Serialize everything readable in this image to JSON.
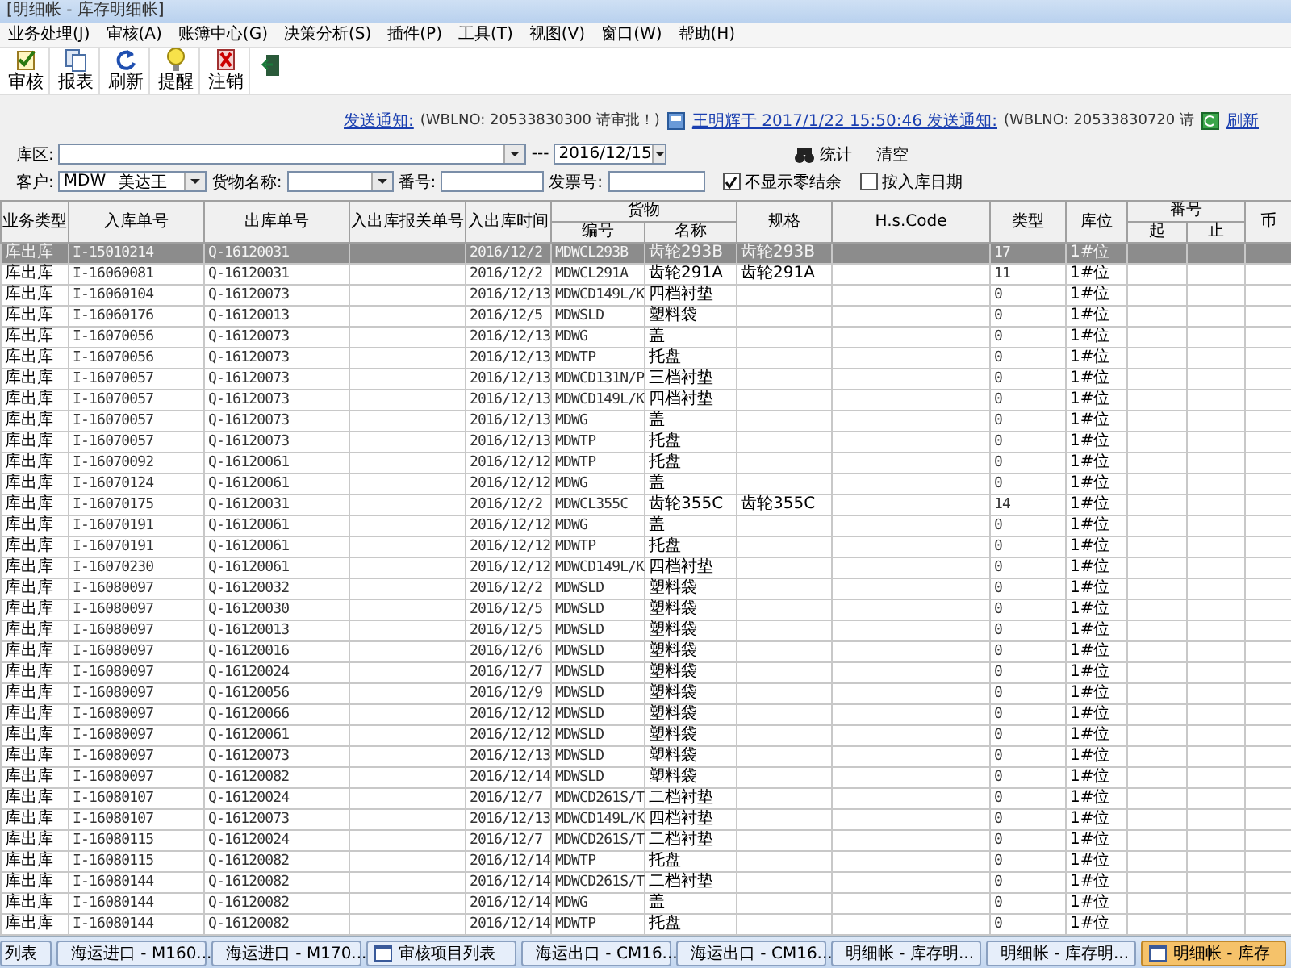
{
  "window": {
    "title": "[明细帐 - 库存明细帐]"
  },
  "menu": [
    {
      "label": "业务处理(J)"
    },
    {
      "label": "审核(A)"
    },
    {
      "label": "账簿中心(G)"
    },
    {
      "label": "决策分析(S)"
    },
    {
      "label": "插件(P)"
    },
    {
      "label": "工具(T)"
    },
    {
      "label": "视图(V)"
    },
    {
      "label": "窗口(W)"
    },
    {
      "label": "帮助(H)"
    }
  ],
  "toolbar": [
    {
      "label": "审核"
    },
    {
      "label": "报表"
    },
    {
      "label": "刷新"
    },
    {
      "label": "提醒"
    },
    {
      "label": "注销"
    },
    {
      "kind": "icon"
    }
  ],
  "notification": {
    "link_1": "发送通知:",
    "text_1": "(WBLNO: 20533830300 请审批！)",
    "link_2": "王明辉于 2017/1/22 15:50:46 发送通知:",
    "text_2": "(WBLNO: 20533830720 请",
    "refresh": "刷新"
  },
  "filters": {
    "area_label": "库区:",
    "separator": "---",
    "date": "2016/12/15",
    "stats_button": "统计",
    "clear_button": "清空",
    "customer_label": "客户:",
    "customer_code": "MDW",
    "customer_name": "美达王",
    "goods_label": "货物名称:",
    "number_label": "番号:",
    "invoice_label": "发票号:",
    "options": [
      {
        "label": "不显示零结余",
        "checked": true
      },
      {
        "label": "按入库日期",
        "checked": false
      }
    ]
  },
  "table": {
    "columns": [
      {
        "label": "业务类型"
      },
      {
        "label": "入库单号"
      },
      {
        "label": "出库单号"
      },
      {
        "label": "入出库报关单号"
      },
      {
        "label": "入出库时间"
      },
      {
        "label": "货物",
        "children": [
          "编号",
          "名称"
        ]
      },
      {
        "label": "规格"
      },
      {
        "label": "H.s.Code"
      },
      {
        "label": "类型"
      },
      {
        "label": "库位"
      },
      {
        "label": "番号",
        "children": [
          "起",
          "止"
        ]
      },
      {
        "label": "币"
      }
    ],
    "rows": [
      {
        "selected": true,
        "type": "库出库",
        "in_no": "I-15010214",
        "out_no": "Q-16120031",
        "time": "2016/12/2",
        "code": "MDWCL293B",
        "name": "齿轮293B",
        "spec": "齿轮293B",
        "kind": "17",
        "location": "1#位"
      },
      {
        "selected": false,
        "type": "库出库",
        "in_no": "I-16060081",
        "out_no": "Q-16120031",
        "time": "2016/12/2",
        "code": "MDWCL291A",
        "name": "齿轮291A",
        "spec": "齿轮291A",
        "kind": "11",
        "location": "1#位"
      },
      {
        "selected": false,
        "type": "库出库",
        "in_no": "I-16060104",
        "out_no": "Q-16120073",
        "time": "2016/12/13",
        "code": "MDWCD149L/K",
        "name": "四档衬垫",
        "kind": "0",
        "location": "1#位"
      },
      {
        "selected": false,
        "type": "库出库",
        "in_no": "I-16060176",
        "out_no": "Q-16120013",
        "time": "2016/12/5",
        "code": "MDWSLD",
        "name": "塑料袋",
        "kind": "0",
        "location": "1#位"
      },
      {
        "selected": false,
        "type": "库出库",
        "in_no": "I-16070056",
        "out_no": "Q-16120073",
        "time": "2016/12/13",
        "code": "MDWG",
        "name": "盖",
        "kind": "0",
        "location": "1#位"
      },
      {
        "selected": false,
        "type": "库出库",
        "in_no": "I-16070056",
        "out_no": "Q-16120073",
        "time": "2016/12/13",
        "code": "MDWTP",
        "name": "托盘",
        "kind": "0",
        "location": "1#位"
      },
      {
        "selected": false,
        "type": "库出库",
        "in_no": "I-16070057",
        "out_no": "Q-16120073",
        "time": "2016/12/13",
        "code": "MDWCD131N/P",
        "name": "三档衬垫",
        "kind": "0",
        "location": "1#位"
      },
      {
        "selected": false,
        "type": "库出库",
        "in_no": "I-16070057",
        "out_no": "Q-16120073",
        "time": "2016/12/13",
        "code": "MDWCD149L/K",
        "name": "四档衬垫",
        "kind": "0",
        "location": "1#位"
      },
      {
        "selected": false,
        "type": "库出库",
        "in_no": "I-16070057",
        "out_no": "Q-16120073",
        "time": "2016/12/13",
        "code": "MDWG",
        "name": "盖",
        "kind": "0",
        "location": "1#位"
      },
      {
        "selected": false,
        "type": "库出库",
        "in_no": "I-16070057",
        "out_no": "Q-16120073",
        "time": "2016/12/13",
        "code": "MDWTP",
        "name": "托盘",
        "kind": "0",
        "location": "1#位"
      },
      {
        "selected": false,
        "type": "库出库",
        "in_no": "I-16070092",
        "out_no": "Q-16120061",
        "time": "2016/12/12",
        "code": "MDWTP",
        "name": "托盘",
        "kind": "0",
        "location": "1#位"
      },
      {
        "selected": false,
        "type": "库出库",
        "in_no": "I-16070124",
        "out_no": "Q-16120061",
        "time": "2016/12/12",
        "code": "MDWG",
        "name": "盖",
        "kind": "0",
        "location": "1#位"
      },
      {
        "selected": false,
        "type": "库出库",
        "in_no": "I-16070175",
        "out_no": "Q-16120031",
        "time": "2016/12/2",
        "code": "MDWCL355C",
        "name": "齿轮355C",
        "spec": "齿轮355C",
        "kind": "14",
        "location": "1#位"
      },
      {
        "selected": false,
        "type": "库出库",
        "in_no": "I-16070191",
        "out_no": "Q-16120061",
        "time": "2016/12/12",
        "code": "MDWG",
        "name": "盖",
        "kind": "0",
        "location": "1#位"
      },
      {
        "selected": false,
        "type": "库出库",
        "in_no": "I-16070191",
        "out_no": "Q-16120061",
        "time": "2016/12/12",
        "code": "MDWTP",
        "name": "托盘",
        "kind": "0",
        "location": "1#位"
      },
      {
        "selected": false,
        "type": "库出库",
        "in_no": "I-16070230",
        "out_no": "Q-16120061",
        "time": "2016/12/12",
        "code": "MDWCD149L/K",
        "name": "四档衬垫",
        "kind": "0",
        "location": "1#位"
      },
      {
        "selected": false,
        "type": "库出库",
        "in_no": "I-16080097",
        "out_no": "Q-16120032",
        "time": "2016/12/2",
        "code": "MDWSLD",
        "name": "塑料袋",
        "kind": "0",
        "location": "1#位"
      },
      {
        "selected": false,
        "type": "库出库",
        "in_no": "I-16080097",
        "out_no": "Q-16120030",
        "time": "2016/12/5",
        "code": "MDWSLD",
        "name": "塑料袋",
        "kind": "0",
        "location": "1#位"
      },
      {
        "selected": false,
        "type": "库出库",
        "in_no": "I-16080097",
        "out_no": "Q-16120013",
        "time": "2016/12/5",
        "code": "MDWSLD",
        "name": "塑料袋",
        "kind": "0",
        "location": "1#位"
      },
      {
        "selected": false,
        "type": "库出库",
        "in_no": "I-16080097",
        "out_no": "Q-16120016",
        "time": "2016/12/6",
        "code": "MDWSLD",
        "name": "塑料袋",
        "kind": "0",
        "location": "1#位"
      },
      {
        "selected": false,
        "type": "库出库",
        "in_no": "I-16080097",
        "out_no": "Q-16120024",
        "time": "2016/12/7",
        "code": "MDWSLD",
        "name": "塑料袋",
        "kind": "0",
        "location": "1#位"
      },
      {
        "selected": false,
        "type": "库出库",
        "in_no": "I-16080097",
        "out_no": "Q-16120056",
        "time": "2016/12/9",
        "code": "MDWSLD",
        "name": "塑料袋",
        "kind": "0",
        "location": "1#位"
      },
      {
        "selected": false,
        "type": "库出库",
        "in_no": "I-16080097",
        "out_no": "Q-16120066",
        "time": "2016/12/12",
        "code": "MDWSLD",
        "name": "塑料袋",
        "kind": "0",
        "location": "1#位"
      },
      {
        "selected": false,
        "type": "库出库",
        "in_no": "I-16080097",
        "out_no": "Q-16120061",
        "time": "2016/12/12",
        "code": "MDWSLD",
        "name": "塑料袋",
        "kind": "0",
        "location": "1#位"
      },
      {
        "selected": false,
        "type": "库出库",
        "in_no": "I-16080097",
        "out_no": "Q-16120073",
        "time": "2016/12/13",
        "code": "MDWSLD",
        "name": "塑料袋",
        "kind": "0",
        "location": "1#位"
      },
      {
        "selected": false,
        "type": "库出库",
        "in_no": "I-16080097",
        "out_no": "Q-16120082",
        "time": "2016/12/14",
        "code": "MDWSLD",
        "name": "塑料袋",
        "kind": "0",
        "location": "1#位"
      },
      {
        "selected": false,
        "type": "库出库",
        "in_no": "I-16080107",
        "out_no": "Q-16120024",
        "time": "2016/12/7",
        "code": "MDWCD261S/T",
        "name": "二档衬垫",
        "kind": "0",
        "location": "1#位"
      },
      {
        "selected": false,
        "type": "库出库",
        "in_no": "I-16080107",
        "out_no": "Q-16120073",
        "time": "2016/12/13",
        "code": "MDWCD149L/K",
        "name": "四档衬垫",
        "kind": "0",
        "location": "1#位"
      },
      {
        "selected": false,
        "type": "库出库",
        "in_no": "I-16080115",
        "out_no": "Q-16120024",
        "time": "2016/12/7",
        "code": "MDWCD261S/T",
        "name": "二档衬垫",
        "kind": "0",
        "location": "1#位"
      },
      {
        "selected": false,
        "type": "库出库",
        "in_no": "I-16080115",
        "out_no": "Q-16120082",
        "time": "2016/12/14",
        "code": "MDWTP",
        "name": "托盘",
        "kind": "0",
        "location": "1#位"
      },
      {
        "selected": false,
        "type": "库出库",
        "in_no": "I-16080144",
        "out_no": "Q-16120082",
        "time": "2016/12/14",
        "code": "MDWCD261S/T",
        "name": "二档衬垫",
        "kind": "0",
        "location": "1#位"
      },
      {
        "selected": false,
        "type": "库出库",
        "in_no": "I-16080144",
        "out_no": "Q-16120082",
        "time": "2016/12/14",
        "code": "MDWG",
        "name": "盖",
        "kind": "0",
        "location": "1#位"
      },
      {
        "selected": false,
        "type": "库出库",
        "in_no": "I-16080144",
        "out_no": "Q-16120082",
        "time": "2016/12/14",
        "code": "MDWTP",
        "name": "托盘",
        "kind": "0",
        "location": "1#位"
      }
    ]
  },
  "taskbar": [
    {
      "label": "列表",
      "selected": false
    },
    {
      "label": "海运进口 - M160...",
      "selected": false
    },
    {
      "label": "海运进口 - M170...",
      "selected": false
    },
    {
      "label": "审核项目列表",
      "selected": false
    },
    {
      "label": "海运出口 - CM16...",
      "selected": false
    },
    {
      "label": "海运出口 - CM16...",
      "selected": false
    },
    {
      "label": "明细帐 - 库存明...",
      "selected": false
    },
    {
      "label": "明细帐 - 库存明...",
      "selected": false
    },
    {
      "label": "明细帐 - 库存",
      "selected": true
    }
  ]
}
